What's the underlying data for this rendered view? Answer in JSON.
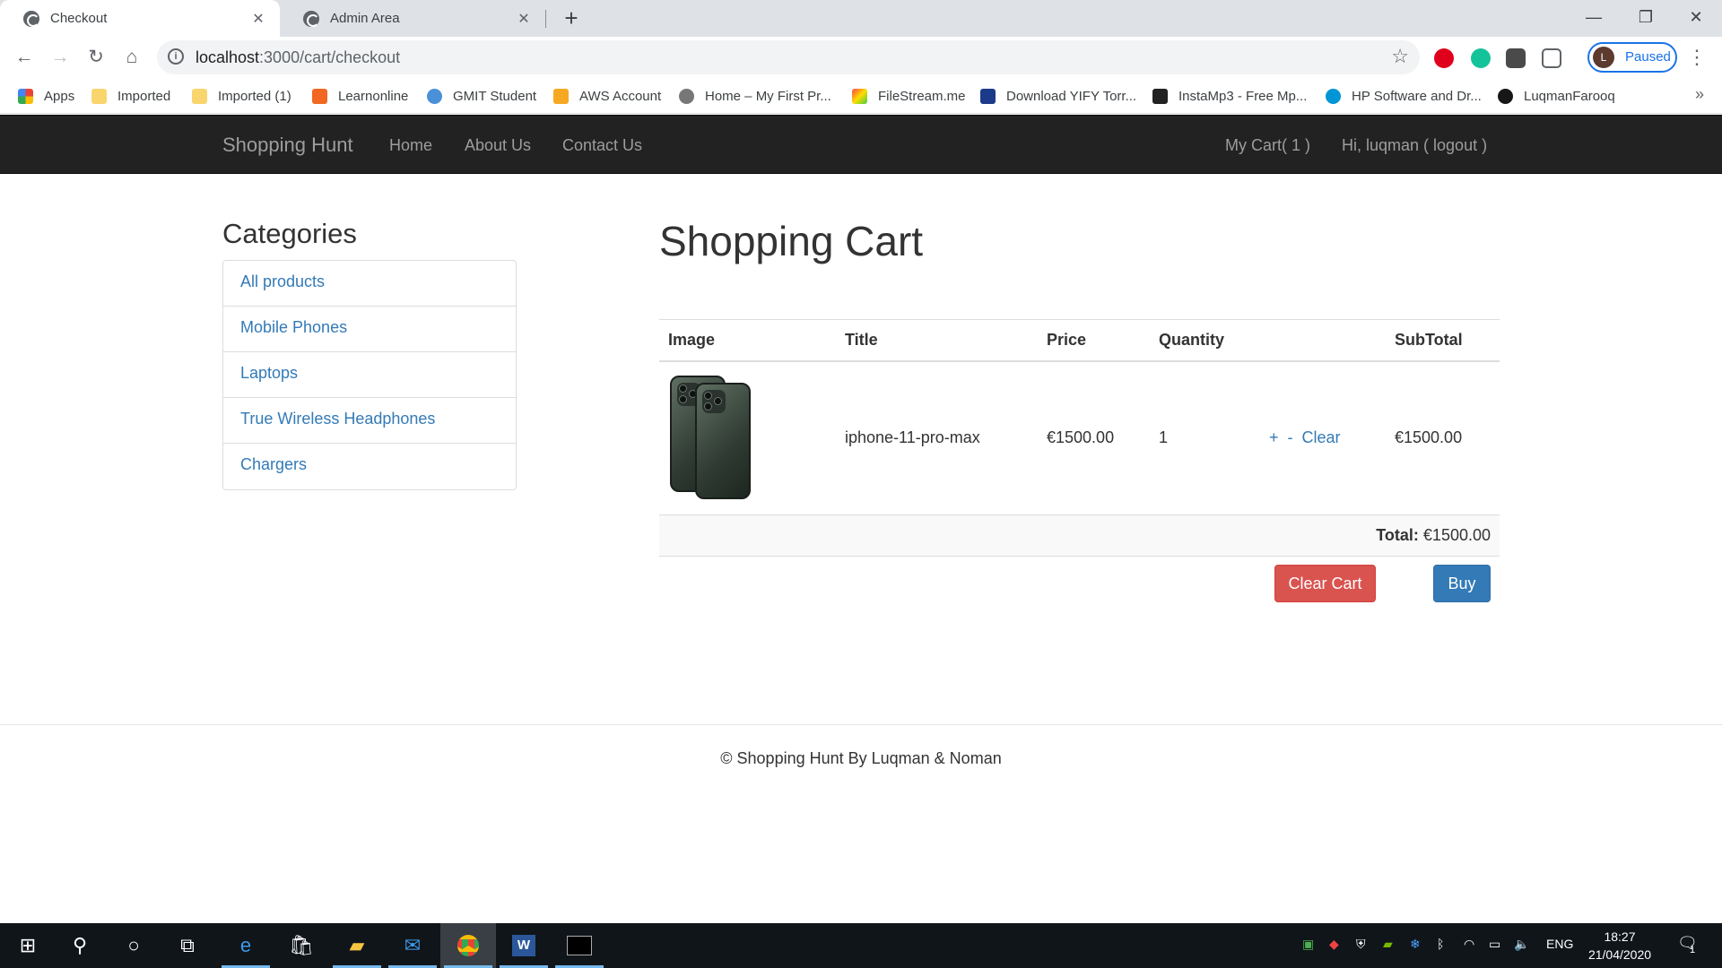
{
  "browser": {
    "tabs": [
      {
        "title": "Checkout",
        "active": true
      },
      {
        "title": "Admin Area",
        "active": false
      }
    ],
    "url_host": "localhost",
    "url_path": ":3000/cart/checkout",
    "profile_initial": "L",
    "profile_status": "Paused",
    "bookmarks": [
      "Apps",
      "Imported",
      "Imported (1)",
      "Learnonline",
      "GMIT Student",
      "AWS Account",
      "Home – My First Pr...",
      "FileStream.me",
      "Download YIFY Torr...",
      "InstaMp3 - Free Mp...",
      "HP Software and Dr...",
      "LuqmanFarooq"
    ],
    "bookmark_more": "»"
  },
  "site": {
    "brand": "Shopping Hunt",
    "nav": [
      "Home",
      "About Us",
      "Contact Us"
    ],
    "cart_link": "My Cart( 1 )",
    "user_link": "Hi, luqman ( logout )"
  },
  "categories": {
    "title": "Categories",
    "items": [
      "All products",
      "Mobile Phones",
      "Laptops",
      "True Wireless Headphones",
      "Chargers"
    ]
  },
  "cart": {
    "title": "Shopping Cart",
    "headers": [
      "Image",
      "Title",
      "Price",
      "Quantity",
      "",
      "SubTotal"
    ],
    "items": [
      {
        "title": "iphone-11-pro-max",
        "price": "€1500.00",
        "quantity": "1",
        "plus": "+",
        "minus": "-",
        "clear": "Clear",
        "subtotal": "€1500.00"
      }
    ],
    "total_label": "Total:",
    "total_value": " €1500.00",
    "clear_cart_label": "Clear Cart",
    "buy_label": "Buy"
  },
  "footer": {
    "text": "© Shopping Hunt By Luqman & Noman"
  },
  "taskbar": {
    "lang": "ENG",
    "time": "18:27",
    "date": "21/04/2020",
    "notifications": "1"
  }
}
